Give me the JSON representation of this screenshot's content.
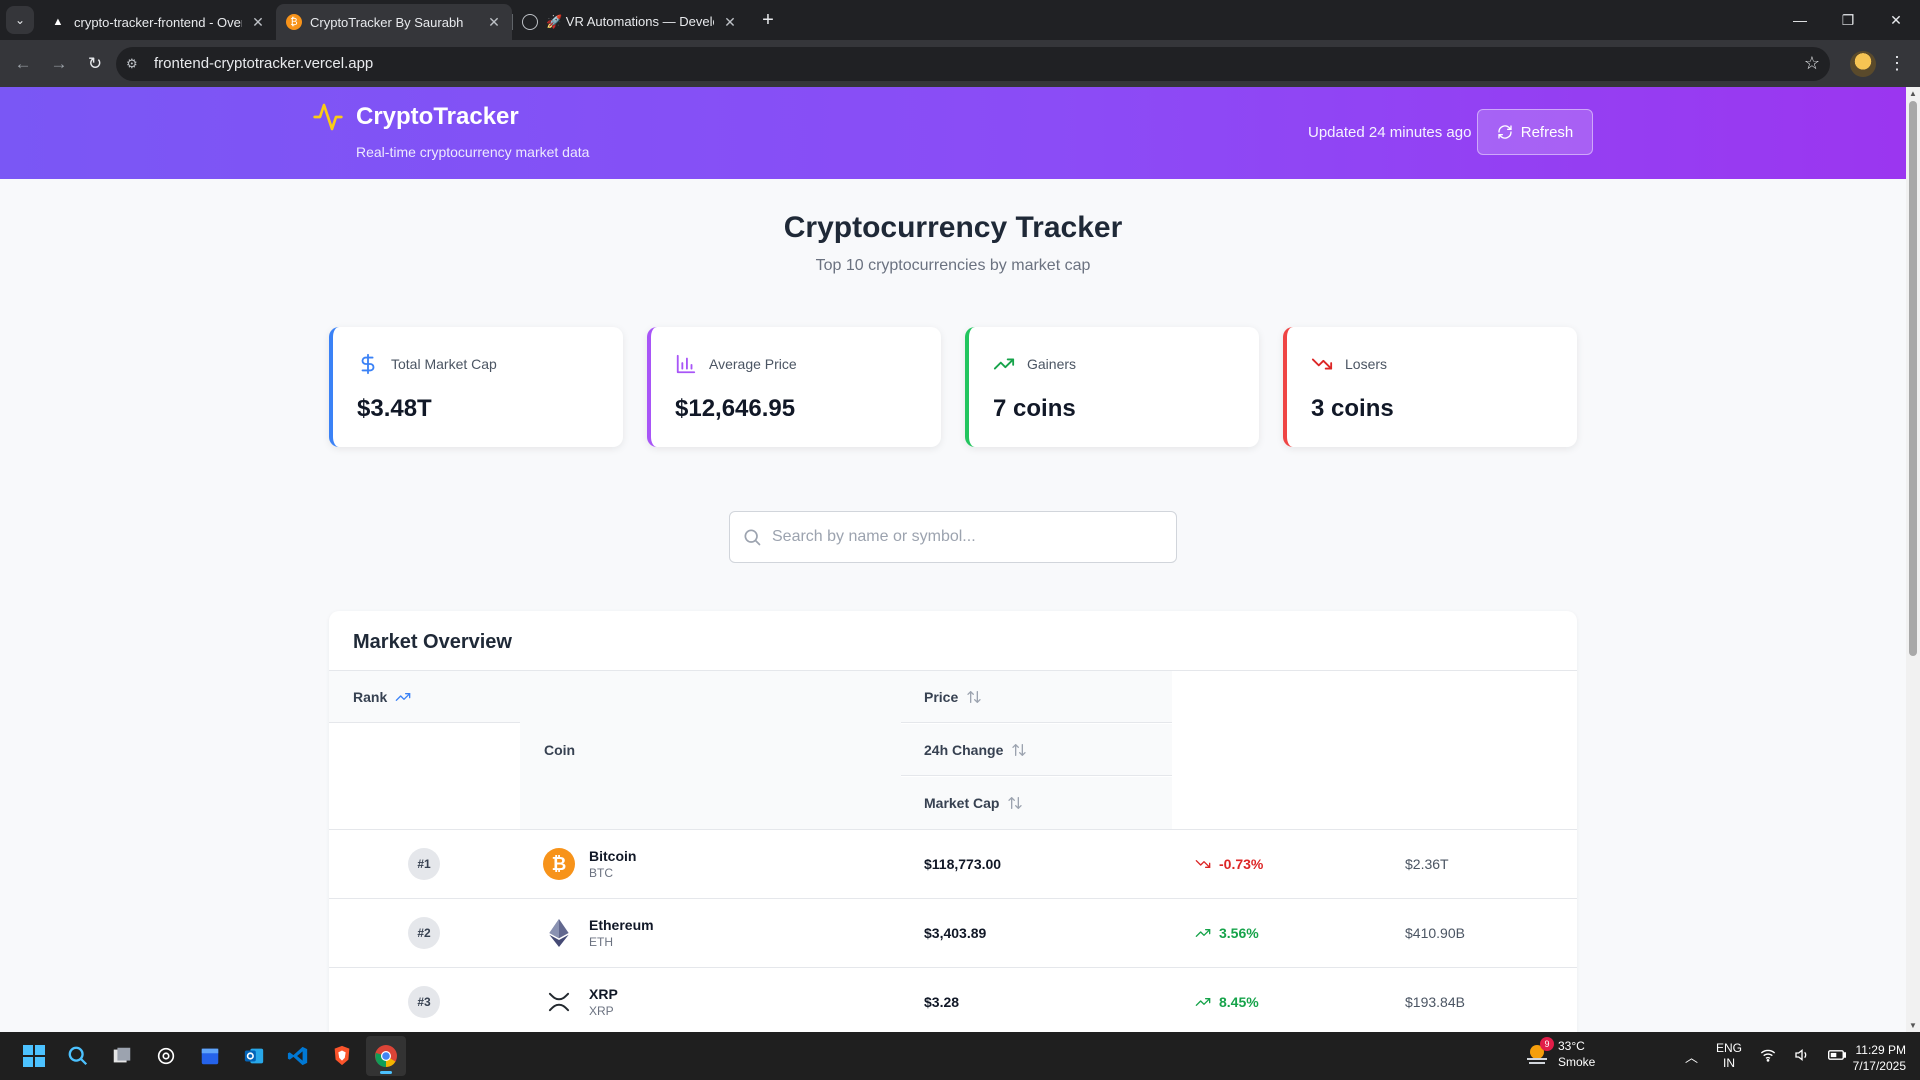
{
  "browser": {
    "tabs": [
      {
        "title": "crypto-tracker-frontend - Overview",
        "active": false
      },
      {
        "title": "CryptoTracker By Saurabh",
        "active": true
      },
      {
        "title": "🚀 VR Automations — Developer",
        "active": false
      }
    ],
    "url": "frontend-cryptotracker.vercel.app"
  },
  "header": {
    "brand": "CryptoTracker",
    "tagline": "Real-time cryptocurrency market data",
    "updated": "Updated 24 minutes ago",
    "refresh_label": "Refresh"
  },
  "page": {
    "title": "Cryptocurrency Tracker",
    "subtitle": "Top 10 cryptocurrencies by market cap"
  },
  "stats": [
    {
      "label": "Total Market Cap",
      "value": "$3.48T",
      "icon": "dollar-icon",
      "color": "#3b82f6"
    },
    {
      "label": "Average Price",
      "value": "$12,646.95",
      "icon": "bar-chart-icon",
      "color": "#a855f7"
    },
    {
      "label": "Gainers",
      "value": "7 coins",
      "icon": "trending-up-icon",
      "color": "#22c55e"
    },
    {
      "label": "Losers",
      "value": "3 coins",
      "icon": "trending-down-icon",
      "color": "#ef4444"
    }
  ],
  "search": {
    "placeholder": "Search by name or symbol..."
  },
  "market": {
    "title": "Market Overview",
    "columns": {
      "rank": "Rank",
      "coin": "Coin",
      "price": "Price",
      "change": "24h Change",
      "market_cap": "Market Cap"
    },
    "rows": [
      {
        "rank": "#1",
        "name": "Bitcoin",
        "symbol": "BTC",
        "price": "$118,773.00",
        "change": "-0.73%",
        "direction": "down",
        "market_cap": "$2.36T",
        "icon": "bitcoin-icon"
      },
      {
        "rank": "#2",
        "name": "Ethereum",
        "symbol": "ETH",
        "price": "$3,403.89",
        "change": "3.56%",
        "direction": "up",
        "market_cap": "$410.90B",
        "icon": "ethereum-icon"
      },
      {
        "rank": "#3",
        "name": "XRP",
        "symbol": "XRP",
        "price": "$3.28",
        "change": "8.45%",
        "direction": "up",
        "market_cap": "$193.84B",
        "icon": "xrp-icon"
      }
    ]
  },
  "colors": {
    "up": "#16a34a",
    "down": "#dc2626",
    "accent": "#8b5cf6"
  },
  "taskbar": {
    "weather_temp": "33°C",
    "weather_desc": "Smoke",
    "weather_badge": "9",
    "lang_1": "ENG",
    "lang_2": "IN",
    "time": "11:29 PM",
    "date": "7/17/2025"
  }
}
